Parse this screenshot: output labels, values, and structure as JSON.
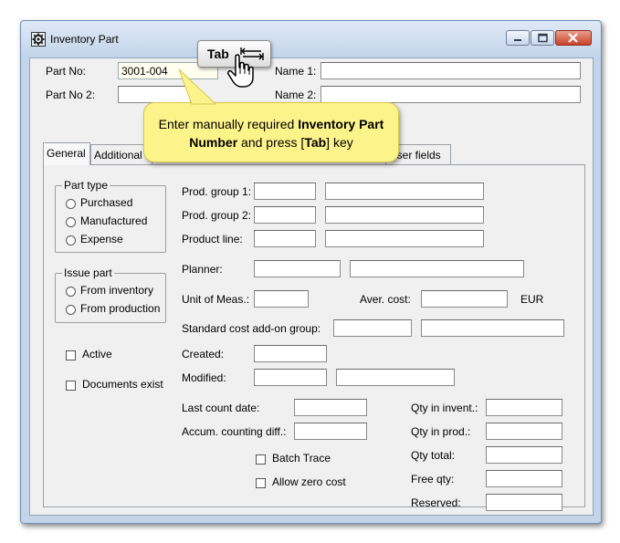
{
  "window": {
    "title": "Inventory Part",
    "icon": "gear-icon",
    "controls": [
      "minimize-icon",
      "maximize-icon",
      "close-icon"
    ]
  },
  "header": {
    "part_no_label": "Part No:",
    "part_no_value": "3001-004",
    "part_no2_label": "Part No 2:",
    "name1_label": "Name 1:",
    "name2_label": "Name 2:"
  },
  "tabs": [
    {
      "label": "General",
      "active": true
    },
    {
      "label": "Additional"
    },
    {
      "label": "User fields"
    }
  ],
  "general": {
    "part_type": {
      "title": "Part type",
      "options": [
        "Purchased",
        "Manufactured",
        "Expense"
      ]
    },
    "issue_part": {
      "title": "Issue part",
      "options": [
        "From inventory",
        "From production"
      ]
    },
    "active_label": "Active",
    "documents_exist_label": "Documents exist",
    "prod_group1_label": "Prod. group 1:",
    "prod_group2_label": "Prod. group 2:",
    "product_line_label": "Product line:",
    "planner_label": "Planner:",
    "unit_of_meas_label": "Unit of Meas.:",
    "aver_cost_label": "Aver. cost:",
    "currency": "EUR",
    "std_cost_addon_label": "Standard cost add-on group:",
    "created_label": "Created:",
    "modified_label": "Modified:",
    "last_count_date_label": "Last count date:",
    "accum_counting_diff_label": "Accum. counting diff.:",
    "batch_trace_label": "Batch Trace",
    "allow_zero_cost_label": "Allow zero cost",
    "qty_in_invent_label": "Qty in invent.:",
    "qty_in_prod_label": "Qty in prod.:",
    "qty_total_label": "Qty total:",
    "free_qty_label": "Free qty:",
    "reserved_label": "Reserved:"
  },
  "callout": {
    "text_pre": "Enter manually required ",
    "text_bold1": "Inventory Part Number",
    "text_mid": " and press [",
    "text_bold2": "Tab",
    "text_post": "] key"
  },
  "tab_key": {
    "label": "Tab",
    "icon": "tab-key-icon"
  },
  "pointer_icon": "hand-pointer-icon"
}
